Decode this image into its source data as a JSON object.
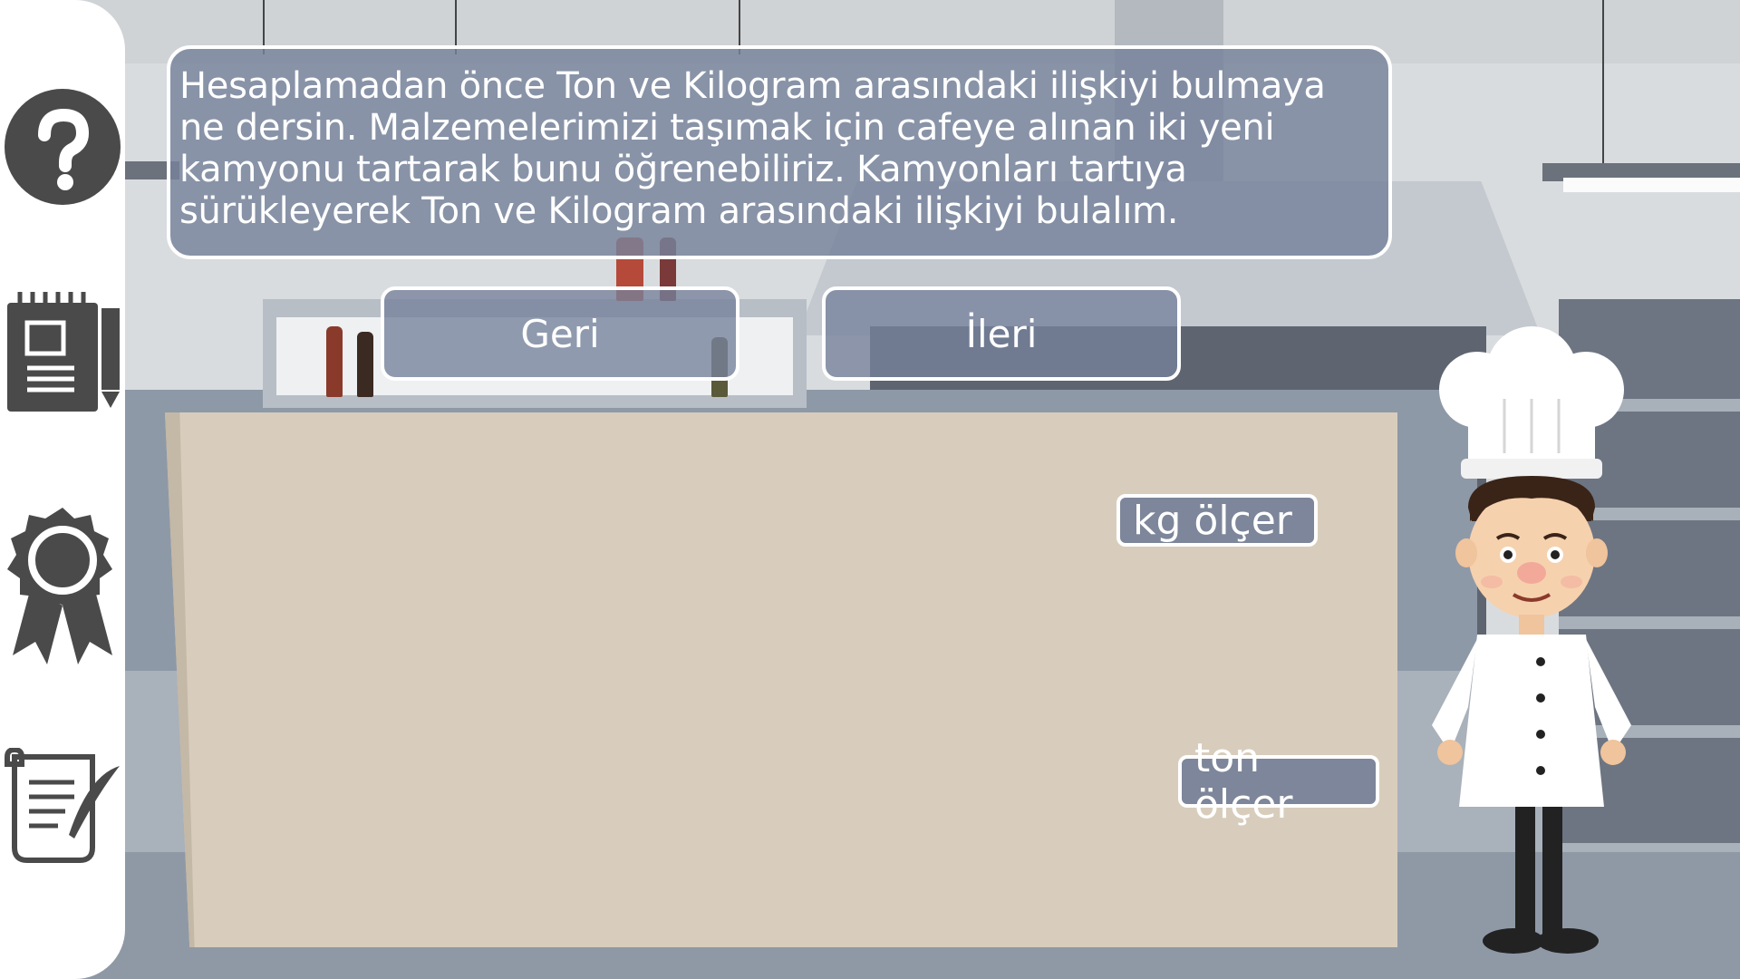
{
  "sidebar": {
    "items": [
      {
        "icon": "question-mark-icon"
      },
      {
        "icon": "notepad-icon"
      },
      {
        "icon": "award-ribbon-icon"
      },
      {
        "icon": "scroll-quill-icon"
      }
    ]
  },
  "dialog": {
    "text": "Hesaplamadan önce Ton ve Kilogram arasındaki ilişkiyi bulmaya ne dersin. Malzemelerimizi taşımak için cafeye alınan iki yeni kamyonu tartarak bunu öğrenebiliriz. Kamyonları tartıya sürükleyerek Ton ve Kilogram arasındaki ilişkiyi bulalım."
  },
  "nav": {
    "back_label": "Geri",
    "next_label": "İleri"
  },
  "board": {
    "items": [
      {
        "label": "kg ölçer"
      },
      {
        "label": "ton ölçer"
      }
    ]
  },
  "colors": {
    "panel": "#76829b",
    "board": "#d8cdbc",
    "sidebar": "#ffffff",
    "icon": "#4a4a4a"
  },
  "character": {
    "icon": "chef-character"
  }
}
